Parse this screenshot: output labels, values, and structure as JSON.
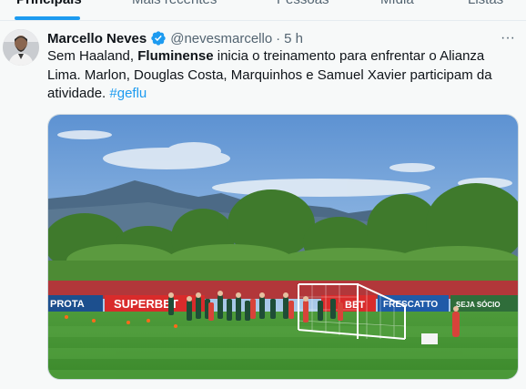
{
  "tabs": [
    {
      "label": "Principais",
      "active": true
    },
    {
      "label": "Mais recentes",
      "active": false
    },
    {
      "label": "Pessoas",
      "active": false
    },
    {
      "label": "Mídia",
      "active": false
    },
    {
      "label": "Listas",
      "active": false
    }
  ],
  "tweet": {
    "author_name": "Marcello Neves",
    "handle": "@nevesmarcello",
    "separator": "·",
    "time": "5 h",
    "text_part1": "Sem Haaland, ",
    "text_bold": "Fluminense",
    "text_part2": " inicia o treinamento para enfrentar o Alianza Lima. Marlon, Douglas Costa, Marquinhos e Samuel Xavier participam da atividade. ",
    "hashtag": "#geflu",
    "more_label": "···",
    "media": {
      "boards": [
        "PROTA",
        "SUPERBET",
        "BET",
        "FRESCATTO",
        "SEJA SÓCIO"
      ]
    }
  },
  "colors": {
    "accent": "#1d9bf0",
    "text": "#0f1419",
    "muted": "#536471",
    "background": "#f7f9f9"
  },
  "icons": {
    "verified": "verified-badge-icon",
    "more": "more-options-icon"
  }
}
